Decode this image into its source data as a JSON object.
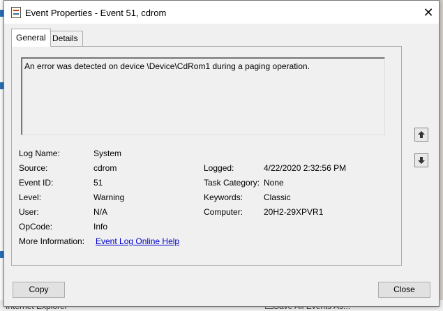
{
  "window": {
    "title": "Event Properties - Event 51, cdrom",
    "close_label": "✕"
  },
  "tabs": [
    {
      "label": "General",
      "active": true
    },
    {
      "label": "Details",
      "active": false
    }
  ],
  "description": "An error was detected on device \\Device\\CdRom1 during a paging operation.",
  "fields": {
    "log_name": {
      "label": "Log Name:",
      "value": "System"
    },
    "source": {
      "label": "Source:",
      "value": "cdrom"
    },
    "event_id": {
      "label": "Event ID:",
      "value": "51"
    },
    "level": {
      "label": "Level:",
      "value": "Warning"
    },
    "user": {
      "label": "User:",
      "value": "N/A"
    },
    "opcode": {
      "label": "OpCode:",
      "value": "Info"
    },
    "more_info": {
      "label": "More Information:",
      "value": "Event Log Online Help"
    },
    "logged": {
      "label": "Logged:",
      "value": "4/22/2020 2:32:56 PM"
    },
    "task_category": {
      "label": "Task Category:",
      "value": "None"
    },
    "keywords": {
      "label": "Keywords:",
      "value": "Classic"
    },
    "computer": {
      "label": "Computer:",
      "value": "20H2-29XPVR1"
    }
  },
  "buttons": {
    "copy": "Copy",
    "close": "Close"
  },
  "background": {
    "left_text": "Internet Explorer",
    "right_text": "Save All Events As..."
  },
  "icons": {
    "title": "event-viewer-icon",
    "up": "up-arrow-icon",
    "down": "down-arrow-icon"
  }
}
